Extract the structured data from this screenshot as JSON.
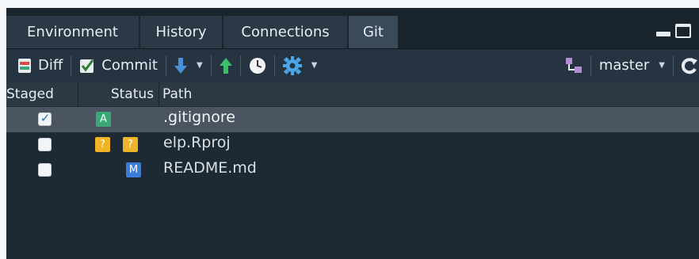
{
  "tabs": [
    {
      "label": "Environment",
      "active": false
    },
    {
      "label": "History",
      "active": false
    },
    {
      "label": "Connections",
      "active": false
    },
    {
      "label": "Git",
      "active": true
    }
  ],
  "toolbar": {
    "diff_label": "Diff",
    "commit_label": "Commit",
    "branch": "master"
  },
  "columns": {
    "staged": "Staged",
    "status": "Status",
    "path": "Path"
  },
  "files": [
    {
      "staged": true,
      "status": [
        "A"
      ],
      "path": ".gitignore",
      "selected": true
    },
    {
      "staged": false,
      "status": [
        "?",
        "?"
      ],
      "path": "elp.Rproj",
      "selected": false
    },
    {
      "staged": false,
      "status": [
        "M"
      ],
      "path": "README.md",
      "selected": false
    }
  ],
  "colors": {
    "panel_bg": "#1e2a33",
    "added": "#3aa876",
    "untracked": "#f0b429",
    "modified": "#3b7bd9",
    "selected_row": "#4a5561"
  }
}
